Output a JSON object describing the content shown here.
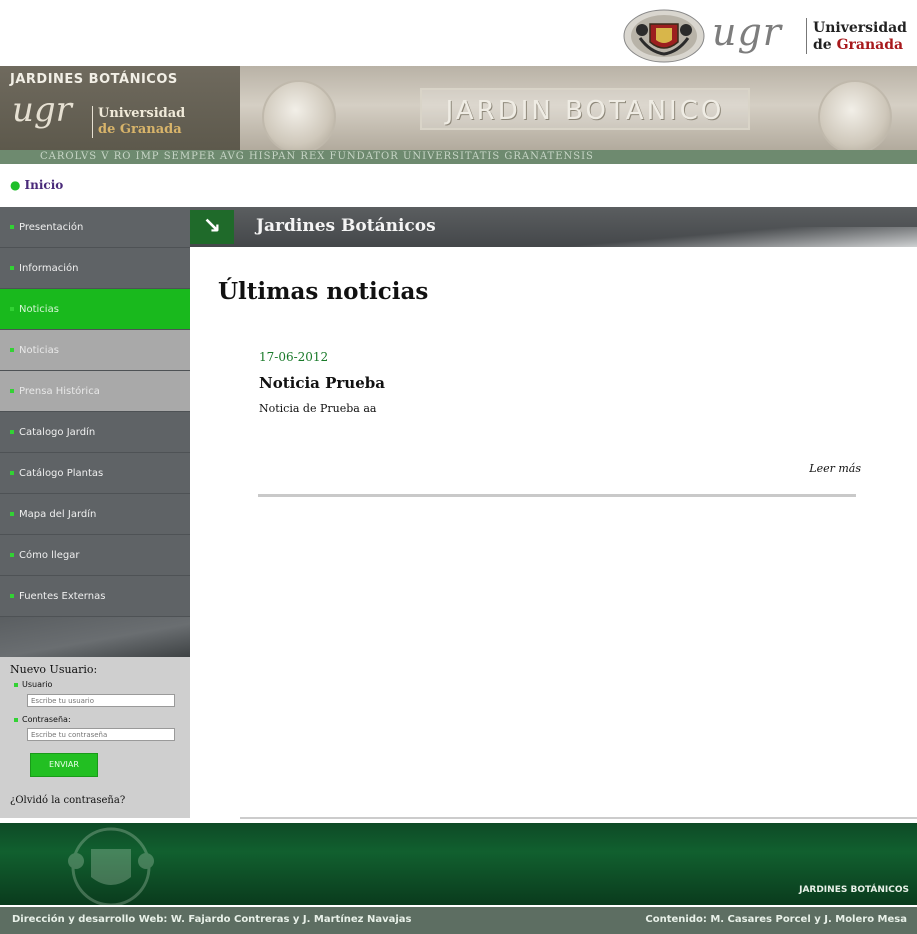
{
  "header": {
    "university_mark": "ugr",
    "university_name_line1": "Universidad",
    "university_name_line2_prefix": "de",
    "university_name_line2_city": "Granada"
  },
  "banner": {
    "title": "JARDINES BOTÁNICOS",
    "ugr_mark": "ugr",
    "ugr_line1": "Universidad",
    "ugr_line2": "de Granada",
    "relief_text": "JARDIN BOTANICO",
    "motto": "CAROLVS V RO IMP SEMPER AVG HISPAN REX FUNDATOR UNIVERSITATIS GRANATENSIS"
  },
  "breadcrumb": {
    "label": "Inicio"
  },
  "sidebar": {
    "items": [
      {
        "label": "Presentación"
      },
      {
        "label": "Información"
      },
      {
        "label": "Noticias"
      },
      {
        "label": "Noticias"
      },
      {
        "label": "Prensa Histórica"
      },
      {
        "label": "Catalogo Jardín"
      },
      {
        "label": "Catálogo Plantas"
      },
      {
        "label": "Mapa del Jardín"
      },
      {
        "label": "Cómo llegar"
      },
      {
        "label": "Fuentes Externas"
      }
    ],
    "active_index": 2
  },
  "login": {
    "title": "Nuevo Usuario:",
    "user_label": "Usuario",
    "user_placeholder": "Escribe tu usuario",
    "password_label": "Contraseña:",
    "password_placeholder": "Escribe tu contraseña",
    "submit_label": "ENVIAR",
    "forgot_label": "¿Olvidó la contraseña?"
  },
  "section": {
    "title": "Jardines Botánicos",
    "icon": "arrow-down-right-icon"
  },
  "main": {
    "heading": "Últimas noticias",
    "news": [
      {
        "date": "17-06-2012",
        "title": "Noticia Prueba",
        "body": "Noticia de Prueba aa",
        "read_more": "Leer más"
      }
    ]
  },
  "footer": {
    "brand": "JARDINES BOTÁNICOS",
    "credit_left": "Dirección y desarrollo Web: W. Fajardo Contreras y J. Martínez Navajas",
    "credit_right": "Contenido: M. Casares Porcel y J. Molero Mesa"
  },
  "colors": {
    "accent_green": "#19b91d",
    "sidebar_gray": "#5f6366",
    "footer_green": "#0e4a26",
    "university_red": "#a8191c"
  }
}
